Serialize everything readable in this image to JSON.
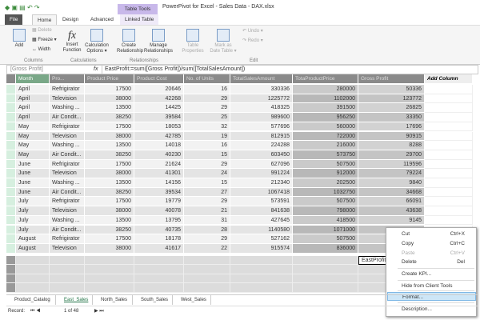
{
  "titlebar": {
    "context_tab": "Table Tools",
    "title": "PowerPivot for Excel - Sales Data - DAX.xlsx"
  },
  "tabs": [
    {
      "label": "File"
    },
    {
      "label": "Home"
    },
    {
      "label": "Design"
    },
    {
      "label": "Advanced"
    },
    {
      "label": "Linked Table"
    }
  ],
  "ribbon": {
    "columns": {
      "add": "Add",
      "delete": "Delete",
      "freeze": "Freeze ▾",
      "width": "Width",
      "group": "Columns"
    },
    "calculations": {
      "insert_function": "Insert Function",
      "calc_options": "Calculation Options ▾",
      "group": "Calculations"
    },
    "relationships": {
      "create": "Create Relationship",
      "manage": "Manage Relationships",
      "group": "Relationships"
    },
    "table_properties": "Table Properties",
    "mark_date": "Mark as Date Table ▾",
    "edit": {
      "undo": "Undo ▾",
      "redo": "Redo ▾",
      "group": "Edit"
    }
  },
  "formula_bar": {
    "name_box": "[Gross Profit]",
    "fx": "fx",
    "formula": "EastProfit:=sum([Gross Profit])/sum([TotalSalesAmount])"
  },
  "table": {
    "headers": [
      "Month",
      "Pro...",
      "Product Price",
      "Product Cost",
      "No. of Units",
      "TotalSalesAmount",
      "TotaProductPrice",
      "Gross Profit",
      "Add Column"
    ],
    "rows": [
      [
        "April",
        "Refrigirator",
        "17500",
        "20646",
        "16",
        "330336",
        "280000",
        "50336"
      ],
      [
        "April",
        "Television",
        "38000",
        "42268",
        "29",
        "1225772",
        "1102000",
        "123772"
      ],
      [
        "April",
        "Washing ...",
        "13500",
        "14425",
        "29",
        "418325",
        "391500",
        "26825"
      ],
      [
        "April",
        "Air Condit...",
        "38250",
        "39584",
        "25",
        "989600",
        "956250",
        "33350"
      ],
      [
        "May",
        "Refrigirator",
        "17500",
        "18053",
        "32",
        "577696",
        "560000",
        "17696"
      ],
      [
        "May",
        "Television",
        "38000",
        "42785",
        "19",
        "812915",
        "722000",
        "90915"
      ],
      [
        "May",
        "Washing ...",
        "13500",
        "14018",
        "16",
        "224288",
        "216000",
        "8288"
      ],
      [
        "May",
        "Air Condit...",
        "38250",
        "40230",
        "15",
        "603450",
        "573750",
        "29700"
      ],
      [
        "June",
        "Refrigirator",
        "17500",
        "21624",
        "29",
        "627096",
        "507500",
        "119596"
      ],
      [
        "June",
        "Television",
        "38000",
        "41301",
        "24",
        "991224",
        "912000",
        "79224"
      ],
      [
        "June",
        "Washing ...",
        "13500",
        "14156",
        "15",
        "212340",
        "202500",
        "9840"
      ],
      [
        "June",
        "Air Condit...",
        "38250",
        "39534",
        "27",
        "1067418",
        "1032750",
        "34668"
      ],
      [
        "July",
        "Refrigirator",
        "17500",
        "19779",
        "29",
        "573591",
        "507500",
        "66091"
      ],
      [
        "July",
        "Television",
        "38000",
        "40078",
        "21",
        "841638",
        "798000",
        "43638"
      ],
      [
        "July",
        "Washing ...",
        "13500",
        "13795",
        "31",
        "427645",
        "418500",
        "9145"
      ],
      [
        "July",
        "Air Condit...",
        "38250",
        "40735",
        "28",
        "1140580",
        "1071000",
        ""
      ],
      [
        "August",
        "Refrigirator",
        "17500",
        "18178",
        "29",
        "527162",
        "507500",
        ""
      ],
      [
        "August",
        "Television",
        "38000",
        "41617",
        "22",
        "915574",
        "836000",
        ""
      ]
    ],
    "measure": "EastProfit"
  },
  "context_menu": [
    {
      "label": "Cut",
      "shortcut": "Ctrl+X"
    },
    {
      "label": "Copy",
      "shortcut": "Ctrl+C"
    },
    {
      "label": "Paste",
      "shortcut": "Ctrl+V",
      "disabled": true
    },
    {
      "label": "Delete",
      "shortcut": "Del"
    },
    {
      "label": "Create KPI..."
    },
    {
      "label": "Hide from Client Tools"
    },
    {
      "label": "Format...",
      "highlighted": true
    },
    {
      "label": "Description..."
    }
  ],
  "sheets": [
    {
      "label": "Product_Catalog"
    },
    {
      "label": "East_Sales",
      "active": true
    },
    {
      "label": "North_Sales"
    },
    {
      "label": "South_Sales"
    },
    {
      "label": "West_Sales"
    }
  ],
  "record": {
    "label": "Record:",
    "value": "1 of 48"
  },
  "colors": {
    "accent": "#217346",
    "context_tab": "#c8b8ea",
    "header": "#8a8a8a",
    "highlight": "#cde6f7"
  }
}
